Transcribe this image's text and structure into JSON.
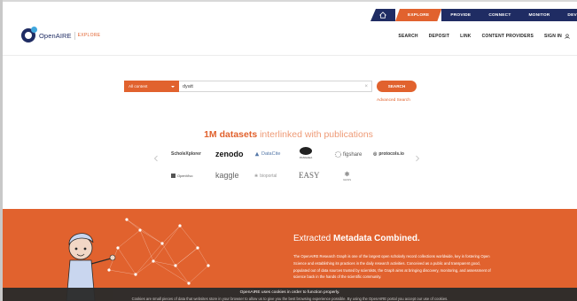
{
  "portal_nav": {
    "items": [
      "EXPLORE",
      "PROVIDE",
      "CONNECT",
      "MONITOR",
      "DEVELOP"
    ]
  },
  "logo": {
    "name": "OpenAIRE",
    "sub": "EXPLORE"
  },
  "main_nav": {
    "items": [
      "SEARCH",
      "DEPOSIT",
      "LINK",
      "CONTENT PROVIDERS"
    ],
    "user_label": "SIGN IN"
  },
  "search": {
    "type_selected": "All content",
    "query": "dyatt",
    "button": "SEARCH",
    "advanced": "Advanced Search"
  },
  "headline": {
    "strong": "1M datasets",
    "rest": "interlinked with publications"
  },
  "providers": {
    "row1": [
      "ScholeXplorer",
      "zenodo",
      "DataCite",
      "PANGAEA",
      "figshare",
      "protocols.io"
    ],
    "row2": [
      "OpenVivo",
      "kaggle",
      "bioportal",
      "EASY",
      "GESIS"
    ]
  },
  "banner": {
    "title_normal": "Extracted",
    "title_bold": "Metadata Combined.",
    "text": "The OpenAIRE Research Graph is one of the largest open scholarly record collections worldwide, key in fostering Open Science and establishing its practices in the daily research activities. Conceived as a public and transparent good, populated out of data sources trusted by scientists, the Graph aims at bringing discovery, monitoring, and assessment of science back in the hands of the scientific community."
  },
  "cookie": {
    "line1": "OpenAIRE uses cookies in order to function properly.",
    "line2": "Cookies are small pieces of data that websites store in your browser to allow us to give you the best browsing experience possible. By using the OpenAIRE portal you accept our use of cookies."
  },
  "colors": {
    "accent": "#e1622e",
    "navy": "#1f2c63",
    "cookie_bg": "#2b2b2b"
  }
}
